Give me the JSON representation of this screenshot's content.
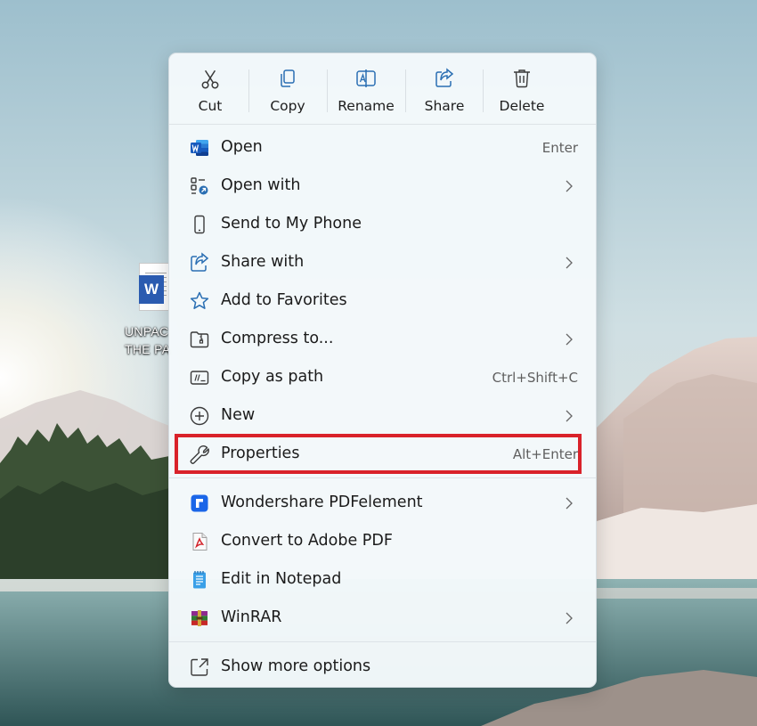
{
  "desktop": {
    "file_icon": "word-document-icon",
    "file_label_line1": "UNPAC",
    "file_label_line2": "THE PA",
    "word_letter": "W"
  },
  "context_menu": {
    "toolbar": [
      {
        "label": "Cut",
        "icon": "scissors-icon"
      },
      {
        "label": "Copy",
        "icon": "copy-icon"
      },
      {
        "label": "Rename",
        "icon": "rename-icon"
      },
      {
        "label": "Share",
        "icon": "share-icon"
      },
      {
        "label": "Delete",
        "icon": "trash-icon"
      }
    ],
    "items": [
      {
        "label": "Open",
        "shortcut": "Enter",
        "icon": "word-icon"
      },
      {
        "label": "Open with",
        "submenu": true,
        "icon": "open-with-icon"
      },
      {
        "label": "Send to My Phone",
        "icon": "phone-icon"
      },
      {
        "label": "Share with",
        "submenu": true,
        "icon": "share-icon"
      },
      {
        "label": "Add to Favorites",
        "icon": "star-icon"
      },
      {
        "label": "Compress to...",
        "submenu": true,
        "icon": "zip-folder-icon"
      },
      {
        "label": "Copy as path",
        "shortcut": "Ctrl+Shift+C",
        "icon": "copy-path-icon"
      },
      {
        "label": "New",
        "submenu": true,
        "icon": "plus-circle-icon"
      },
      {
        "label": "Properties",
        "shortcut": "Alt+Enter",
        "icon": "wrench-icon",
        "highlighted": true
      },
      {
        "label": "Wondershare PDFelement",
        "submenu": true,
        "icon": "pdfelement-icon"
      },
      {
        "label": "Convert to Adobe PDF",
        "icon": "adobe-pdf-icon"
      },
      {
        "label": "Edit in Notepad",
        "icon": "notepad-icon"
      },
      {
        "label": "WinRAR",
        "submenu": true,
        "icon": "winrar-icon"
      },
      {
        "label": "Show more options",
        "icon": "external-link-icon"
      }
    ]
  },
  "colors": {
    "accent_blue": "#2b6fb3",
    "highlight_red": "#d9222a",
    "word_blue": "#2b5bb0",
    "menu_bg": "#f4f9fb"
  }
}
